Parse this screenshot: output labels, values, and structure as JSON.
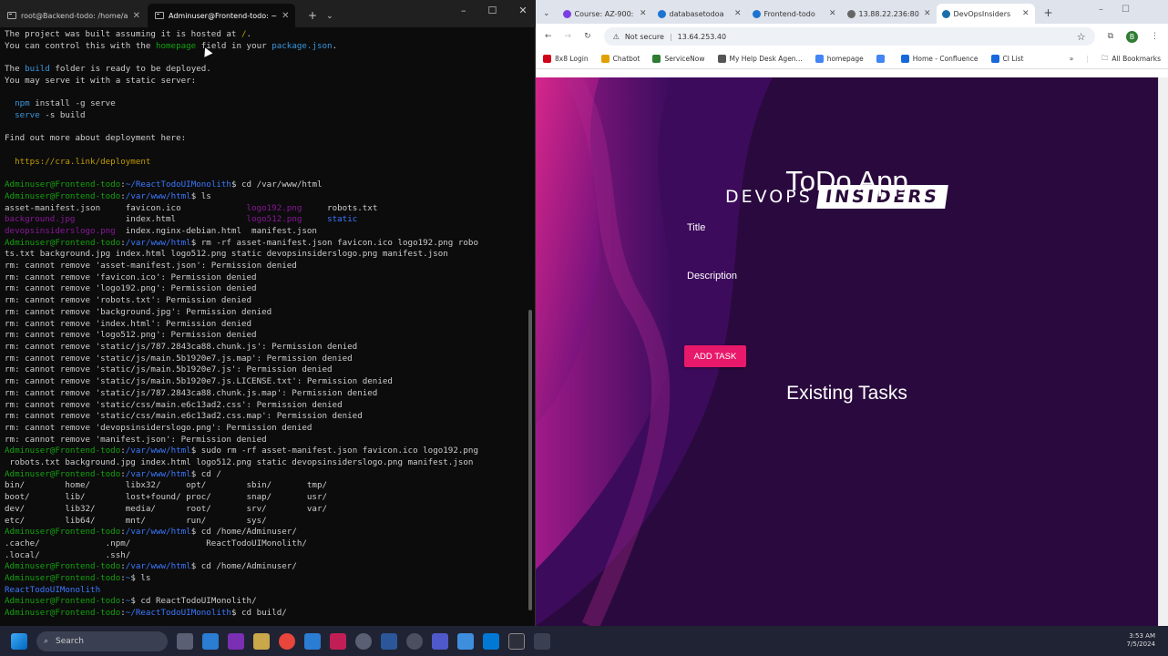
{
  "terminal": {
    "tabs": [
      {
        "label": "root@Backend-todo: /home/a",
        "active": false
      },
      {
        "label": "Adminuser@Frontend-todo: ~",
        "active": true
      }
    ],
    "lines": [
      [
        [
          "w",
          "The project was built assuming it is hosted at "
        ],
        [
          "y",
          "/"
        ],
        [
          "w",
          "."
        ]
      ],
      [
        [
          "w",
          "You can control this with the "
        ],
        [
          "g",
          "homepage"
        ],
        [
          "w",
          " field in your "
        ],
        [
          "c",
          "package.json"
        ],
        [
          "w",
          "."
        ]
      ],
      [
        [
          "w",
          ""
        ]
      ],
      [
        [
          "w",
          "The "
        ],
        [
          "c",
          "build"
        ],
        [
          "w",
          " folder is ready to be deployed."
        ]
      ],
      [
        [
          "w",
          "You may serve it with a static server:"
        ]
      ],
      [
        [
          "w",
          ""
        ]
      ],
      [
        [
          "w",
          "  "
        ],
        [
          "c",
          "npm"
        ],
        [
          "w",
          " install -g serve"
        ]
      ],
      [
        [
          "w",
          "  "
        ],
        [
          "c",
          "serve"
        ],
        [
          "w",
          " -s build"
        ]
      ],
      [
        [
          "w",
          ""
        ]
      ],
      [
        [
          "w",
          "Find out more about deployment here:"
        ]
      ],
      [
        [
          "w",
          ""
        ]
      ],
      [
        [
          "w",
          "  "
        ],
        [
          "y",
          "https://cra.link/deployment"
        ]
      ],
      [
        [
          "w",
          ""
        ]
      ],
      [
        [
          "g",
          "Adminuser@Frontend-todo"
        ],
        [
          "w",
          ":"
        ],
        [
          "b",
          "~/ReactTodoUIMonolith"
        ],
        [
          "w",
          "$ cd /var/www/html"
        ]
      ],
      [
        [
          "g",
          "Adminuser@Frontend-todo"
        ],
        [
          "w",
          ":"
        ],
        [
          "b",
          "/var/www/html"
        ],
        [
          "w",
          "$ ls"
        ]
      ],
      [
        [
          "w",
          "asset-manifest.json     favicon.ico             "
        ],
        [
          "m",
          "logo192.png"
        ],
        [
          "w",
          "     robots.txt"
        ]
      ],
      [
        [
          "m",
          "background.jpg"
        ],
        [
          "w",
          "          index.html              "
        ],
        [
          "m",
          "logo512.png"
        ],
        [
          "w",
          "     "
        ],
        [
          "b",
          "static"
        ]
      ],
      [
        [
          "m",
          "devopsinsiderslogo.png"
        ],
        [
          "w",
          "  index.nginx-debian.html  manifest.json"
        ]
      ],
      [
        [
          "g",
          "Adminuser@Frontend-todo"
        ],
        [
          "w",
          ":"
        ],
        [
          "b",
          "/var/www/html"
        ],
        [
          "w",
          "$ rm -rf asset-manifest.json favicon.ico logo192.png robo"
        ]
      ],
      [
        [
          "w",
          "ts.txt background.jpg index.html logo512.png static devopsinsiderslogo.png manifest.json"
        ]
      ],
      [
        [
          "w",
          "rm: cannot remove 'asset-manifest.json': Permission denied"
        ]
      ],
      [
        [
          "w",
          "rm: cannot remove 'favicon.ico': Permission denied"
        ]
      ],
      [
        [
          "w",
          "rm: cannot remove 'logo192.png': Permission denied"
        ]
      ],
      [
        [
          "w",
          "rm: cannot remove 'robots.txt': Permission denied"
        ]
      ],
      [
        [
          "w",
          "rm: cannot remove 'background.jpg': Permission denied"
        ]
      ],
      [
        [
          "w",
          "rm: cannot remove 'index.html': Permission denied"
        ]
      ],
      [
        [
          "w",
          "rm: cannot remove 'logo512.png': Permission denied"
        ]
      ],
      [
        [
          "w",
          "rm: cannot remove 'static/js/787.2843ca88.chunk.js': Permission denied"
        ]
      ],
      [
        [
          "w",
          "rm: cannot remove 'static/js/main.5b1920e7.js.map': Permission denied"
        ]
      ],
      [
        [
          "w",
          "rm: cannot remove 'static/js/main.5b1920e7.js': Permission denied"
        ]
      ],
      [
        [
          "w",
          "rm: cannot remove 'static/js/main.5b1920e7.js.LICENSE.txt': Permission denied"
        ]
      ],
      [
        [
          "w",
          "rm: cannot remove 'static/js/787.2843ca88.chunk.js.map': Permission denied"
        ]
      ],
      [
        [
          "w",
          "rm: cannot remove 'static/css/main.e6c13ad2.css': Permission denied"
        ]
      ],
      [
        [
          "w",
          "rm: cannot remove 'static/css/main.e6c13ad2.css.map': Permission denied"
        ]
      ],
      [
        [
          "w",
          "rm: cannot remove 'devopsinsiderslogo.png': Permission denied"
        ]
      ],
      [
        [
          "w",
          "rm: cannot remove 'manifest.json': Permission denied"
        ]
      ],
      [
        [
          "g",
          "Adminuser@Frontend-todo"
        ],
        [
          "w",
          ":"
        ],
        [
          "b",
          "/var/www/html"
        ],
        [
          "w",
          "$ sudo rm -rf asset-manifest.json favicon.ico logo192.png"
        ]
      ],
      [
        [
          "w",
          " robots.txt background.jpg index.html logo512.png static devopsinsiderslogo.png manifest.json"
        ]
      ],
      [
        [
          "g",
          "Adminuser@Frontend-todo"
        ],
        [
          "w",
          ":"
        ],
        [
          "b",
          "/var/www/html"
        ],
        [
          "w",
          "$ cd /"
        ]
      ],
      [
        [
          "w",
          "bin/        home/       libx32/     opt/        sbin/       tmp/"
        ]
      ],
      [
        [
          "w",
          "boot/       lib/        lost+found/ proc/       snap/       usr/"
        ]
      ],
      [
        [
          "w",
          "dev/        lib32/      media/      root/       srv/        var/"
        ]
      ],
      [
        [
          "w",
          "etc/        lib64/      mnt/        run/        sys/"
        ]
      ],
      [
        [
          "g",
          "Adminuser@Frontend-todo"
        ],
        [
          "w",
          ":"
        ],
        [
          "b",
          "/var/www/html"
        ],
        [
          "w",
          "$ cd /home/Adminuser/"
        ]
      ],
      [
        [
          "w",
          ".cache/             .npm/               ReactTodoUIMonolith/"
        ]
      ],
      [
        [
          "w",
          ".local/             .ssh/"
        ]
      ],
      [
        [
          "g",
          "Adminuser@Frontend-todo"
        ],
        [
          "w",
          ":"
        ],
        [
          "b",
          "/var/www/html"
        ],
        [
          "w",
          "$ cd /home/Adminuser/"
        ]
      ],
      [
        [
          "g",
          "Adminuser@Frontend-todo"
        ],
        [
          "w",
          ":"
        ],
        [
          "b",
          "~"
        ],
        [
          "w",
          "$ ls"
        ]
      ],
      [
        [
          "b",
          "ReactTodoUIMonolith"
        ]
      ],
      [
        [
          "g",
          "Adminuser@Frontend-todo"
        ],
        [
          "w",
          ":"
        ],
        [
          "b",
          "~"
        ],
        [
          "w",
          "$ cd ReactTodoUIMonolith/"
        ]
      ],
      [
        [
          "g",
          "Adminuser@Frontend-todo"
        ],
        [
          "w",
          ":"
        ],
        [
          "b",
          "~/ReactTodoUIMonolith"
        ],
        [
          "w",
          "$ cd build/"
        ]
      ]
    ]
  },
  "browser": {
    "tabs": [
      {
        "label": "Course: AZ-900:",
        "color": "#7b3fe4"
      },
      {
        "label": "databasetodoa",
        "color": "#1b74d1"
      },
      {
        "label": "Frontend-todo",
        "color": "#1b74d1"
      },
      {
        "label": "13.88.22.236:80",
        "color": "#666666"
      },
      {
        "label": "DevOpsInsiders",
        "color": "#1b6fa8",
        "active": true
      }
    ],
    "security": "Not secure",
    "url": "13.64.253.40",
    "bookmarks": [
      {
        "label": "8x8 Login",
        "color": "#d0021b"
      },
      {
        "label": "Chatbot",
        "color": "#e0a100"
      },
      {
        "label": "ServiceNow",
        "color": "#2e7d32"
      },
      {
        "label": "My Help Desk Agen...",
        "color": "#555555"
      },
      {
        "label": "homepage",
        "color": "#4285f4"
      },
      {
        "label": "",
        "color": "#4285f4"
      },
      {
        "label": "Home - Confluence",
        "color": "#1868db"
      },
      {
        "label": "CI List",
        "color": "#1868db"
      }
    ],
    "all_bookmarks": "All Bookmarks"
  },
  "app": {
    "logo_left": "DEVOPS",
    "logo_right": "INSIDERS",
    "title": "ToDo App",
    "title_label": "Title",
    "description_label": "Description",
    "add_button": "ADD TASK",
    "existing_heading": "Existing Tasks"
  },
  "taskbar": {
    "search_placeholder": "Search",
    "time": "3:53 AM",
    "date": "7/5/2024"
  }
}
